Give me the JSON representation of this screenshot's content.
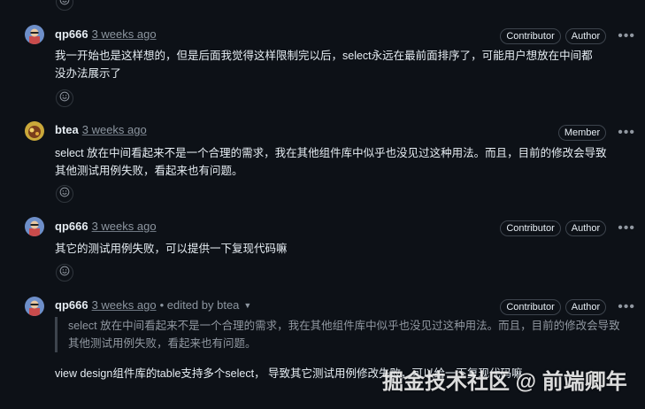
{
  "comments": [
    {
      "author": "qp666",
      "time": "3 weeks ago",
      "badges": [
        "Contributor",
        "Author"
      ],
      "body": "我一开始也是这样想的，但是后面我觉得这样限制完以后，select永远在最前面排序了，可能用户想放在中间都没办法展示了"
    },
    {
      "author": "btea",
      "time": "3 weeks ago",
      "badges": [
        "Member"
      ],
      "body": "select 放在中间看起来不是一个合理的需求，我在其他组件库中似乎也没见过这种用法。而且，目前的修改会导致其他测试用例失败，看起来也有问题。"
    },
    {
      "author": "qp666",
      "time": "3 weeks ago",
      "badges": [
        "Contributor",
        "Author"
      ],
      "body": "其它的测试用例失败，可以提供一下复现代码嘛"
    },
    {
      "author": "qp666",
      "time": "3 weeks ago",
      "edited": "• edited by btea",
      "badges": [
        "Contributor",
        "Author"
      ],
      "quote": "select 放在中间看起来不是一个合理的需求，我在其他组件库中似乎也没见过这种用法。而且，目前的修改会导致其他测试用例失败，看起来也有问题。",
      "body": "view design组件库的table支持多个select， 导致其它测试用例修改失败，可以给一下复现代码嘛"
    }
  ],
  "more_icon": "kebab-horizontal-icon",
  "reaction_icon": "smiley-icon",
  "watermark": "掘金技术社区 @ 前端卿年",
  "colors": {
    "background": "#0d1117",
    "text": "#e6edf3",
    "muted": "#8d96a0",
    "border": "#3d444d"
  }
}
